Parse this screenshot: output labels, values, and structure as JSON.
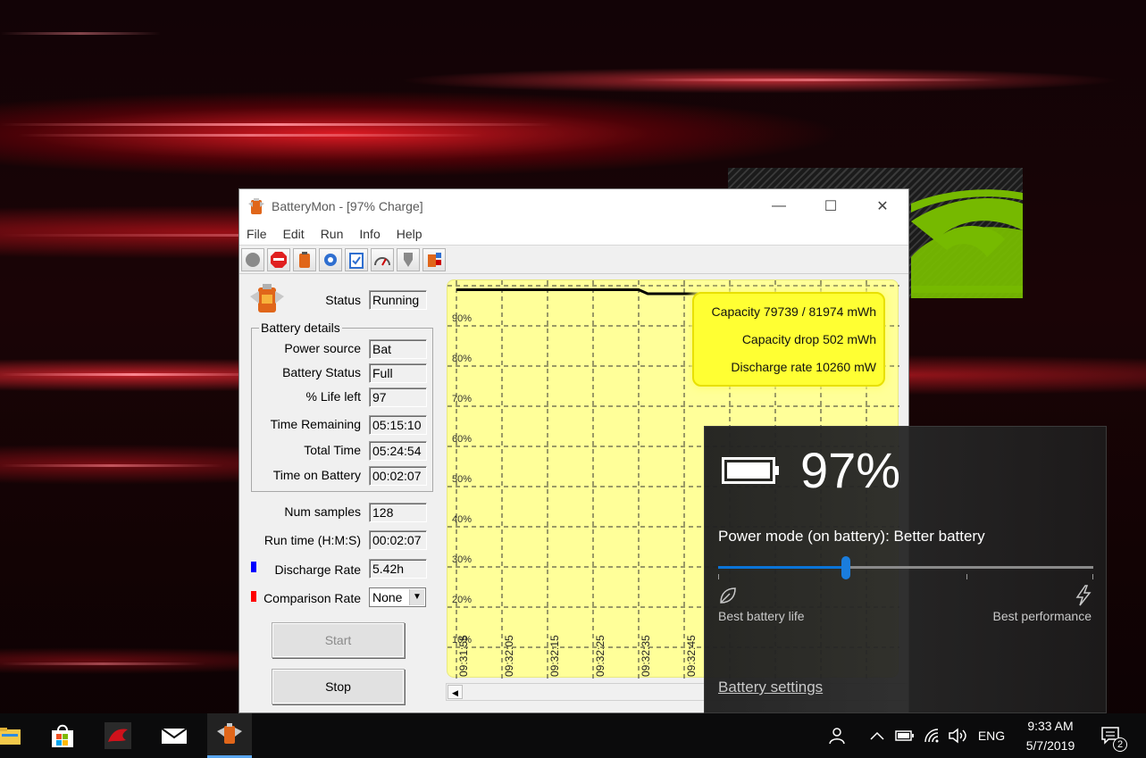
{
  "window": {
    "title": "BatteryMon - [97% Charge]",
    "controls": {
      "minimize": "—",
      "maximize": "☐",
      "close": "✕"
    }
  },
  "menu": [
    "File",
    "Edit",
    "Run",
    "Info",
    "Help"
  ],
  "toolbar": {
    "buttons": [
      "record-icon",
      "stop-icon",
      "battery-icon",
      "settings-icon",
      "clipboard-icon",
      "gauge-icon",
      "plug-icon",
      "battery-info-icon"
    ]
  },
  "status": {
    "label": "Status",
    "value": "Running"
  },
  "battery_details": {
    "title": "Battery details",
    "power_source": {
      "label": "Power source",
      "value": "Bat"
    },
    "battery_status": {
      "label": "Battery Status",
      "value": "Full"
    },
    "life_left": {
      "label": "% Life left",
      "value": "97"
    },
    "time_remaining": {
      "label": "Time Remaining",
      "value": "05:15:10"
    },
    "total_time": {
      "label": "Total Time",
      "value": "05:24:54"
    },
    "time_on_battery": {
      "label": "Time on Battery",
      "value": "00:02:07"
    }
  },
  "num_samples": {
    "label": "Num samples",
    "value": "128"
  },
  "run_time": {
    "label": "Run time (H:M:S)",
    "value": "00:02:07"
  },
  "discharge_rate": {
    "label": "Discharge Rate",
    "value": "5.42h",
    "color": "#0000ff"
  },
  "comparison_rate": {
    "label": "Comparison Rate",
    "value": "None",
    "color": "#ff0000"
  },
  "buttons": {
    "start": "Start",
    "stop": "Stop"
  },
  "chart_info": {
    "capacity": "Capacity 79739 / 81974 mWh",
    "capacity_drop": "Capacity drop 502 mWh",
    "discharge_rate": "Discharge rate 10260 mW"
  },
  "chart_data": {
    "type": "line",
    "y_ticks": [
      "90%",
      "80%",
      "70%",
      "60%",
      "50%",
      "40%",
      "30%",
      "20%",
      "10%"
    ],
    "x_ticks": [
      "09:31:55",
      "09:32:05",
      "09:32:15",
      "09:32:25",
      "09:32:35",
      "09:32:45"
    ],
    "series": [
      {
        "x": [
          "09:31:55",
          "09:32:35",
          "09:32:37",
          "09:32:57"
        ],
        "y": [
          99,
          99,
          98,
          98
        ],
        "color": "#000000"
      }
    ],
    "grid": true,
    "colors": {
      "background": "#ffff99",
      "grid": "#333333"
    }
  },
  "flyout": {
    "percent": "97%",
    "power_mode": "Power mode (on battery): Better battery",
    "slider_level": 0.34,
    "left_label": "Best battery life",
    "right_label": "Best performance",
    "settings_link": "Battery settings"
  },
  "taskbar": {
    "apps": [
      "file-explorer-icon",
      "store-icon",
      "msi-dragon-icon",
      "mail-icon",
      "batterymon-icon"
    ],
    "language": "ENG",
    "time": "9:33 AM",
    "date": "5/7/2019",
    "notification_count": "2"
  }
}
